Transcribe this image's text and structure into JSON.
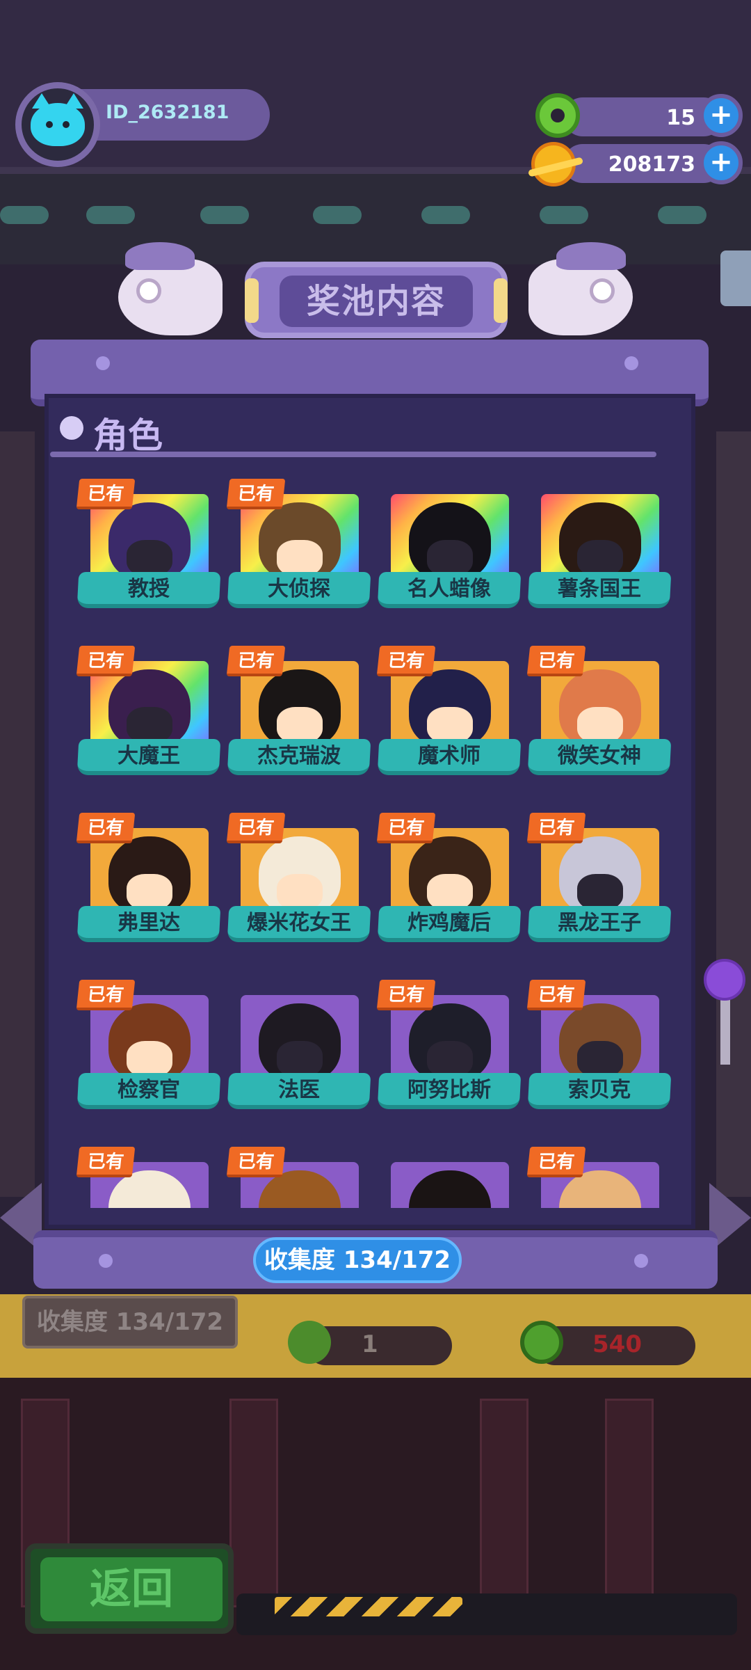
{
  "player": {
    "id": "ID_2632181"
  },
  "currencies": [
    {
      "icon": "donut-currency-icon",
      "value": "15"
    },
    {
      "icon": "planet-coin-icon",
      "value": "208173"
    }
  ],
  "popup": {
    "title": "奖池内容",
    "section_title": "角色",
    "collection_label": "收集度  134/172"
  },
  "items": [
    {
      "name": "教授",
      "owned": "已有",
      "rarity": "rainbow",
      "hair": "#3b2a6a",
      "face": "dark"
    },
    {
      "name": "大侦探",
      "owned": "已有",
      "rarity": "rainbow",
      "hair": "#6b4a2a",
      "face": "light"
    },
    {
      "name": "名人蜡像",
      "owned": "",
      "rarity": "rainbow",
      "hair": "#141218",
      "face": "dark"
    },
    {
      "name": "薯条国王",
      "owned": "",
      "rarity": "rainbow",
      "hair": "#2a1a14",
      "face": "dark"
    },
    {
      "name": "大魔王",
      "owned": "已有",
      "rarity": "rainbow",
      "hair": "#3a1f4e",
      "face": "dark"
    },
    {
      "name": "杰克瑞波",
      "owned": "已有",
      "rarity": "gold",
      "hair": "#1a1616",
      "face": "light"
    },
    {
      "name": "魔术师",
      "owned": "已有",
      "rarity": "gold",
      "hair": "#22204a",
      "face": "light"
    },
    {
      "name": "微笑女神",
      "owned": "已有",
      "rarity": "gold",
      "hair": "#e07a4a",
      "face": "light"
    },
    {
      "name": "弗里达",
      "owned": "已有",
      "rarity": "gold",
      "hair": "#2a1a16",
      "face": "light"
    },
    {
      "name": "爆米花女王",
      "owned": "已有",
      "rarity": "gold",
      "hair": "#f4ead8",
      "face": "light"
    },
    {
      "name": "炸鸡魔后",
      "owned": "已有",
      "rarity": "gold",
      "hair": "#3a2418",
      "face": "light"
    },
    {
      "name": "黑龙王子",
      "owned": "已有",
      "rarity": "gold",
      "hair": "#c8c6d8",
      "face": "dark"
    },
    {
      "name": "检察官",
      "owned": "已有",
      "rarity": "purple",
      "hair": "#7a3a1c",
      "face": "light"
    },
    {
      "name": "法医",
      "owned": "",
      "rarity": "purple",
      "hair": "#1e1a22",
      "face": "dark"
    },
    {
      "name": "阿努比斯",
      "owned": "已有",
      "rarity": "purple",
      "hair": "#1e1e2a",
      "face": "dark"
    },
    {
      "name": "索贝克",
      "owned": "已有",
      "rarity": "purple",
      "hair": "#7a4a2a",
      "face": "dark"
    },
    {
      "name": "",
      "owned": "已有",
      "rarity": "purple",
      "hair": "#f4ead8",
      "face": "light"
    },
    {
      "name": "",
      "owned": "已有",
      "rarity": "purple",
      "hair": "#9a5a22",
      "face": "light"
    },
    {
      "name": "",
      "owned": "",
      "rarity": "purple",
      "hair": "#1a1414",
      "face": "dark"
    },
    {
      "name": "",
      "owned": "已有",
      "rarity": "purple",
      "hair": "#e8b47a",
      "face": "light"
    }
  ],
  "background": {
    "collection_label": "收集度  134/172",
    "cost_1": "1",
    "cost_2": "540",
    "back_button": "返回"
  },
  "colors": {
    "panel": "#332b5c",
    "panel_frame": "#7461ad",
    "label_teal": "#2fb6b3",
    "owned_orange": "#f06a24",
    "accent_blue": "#2f8fe6"
  }
}
